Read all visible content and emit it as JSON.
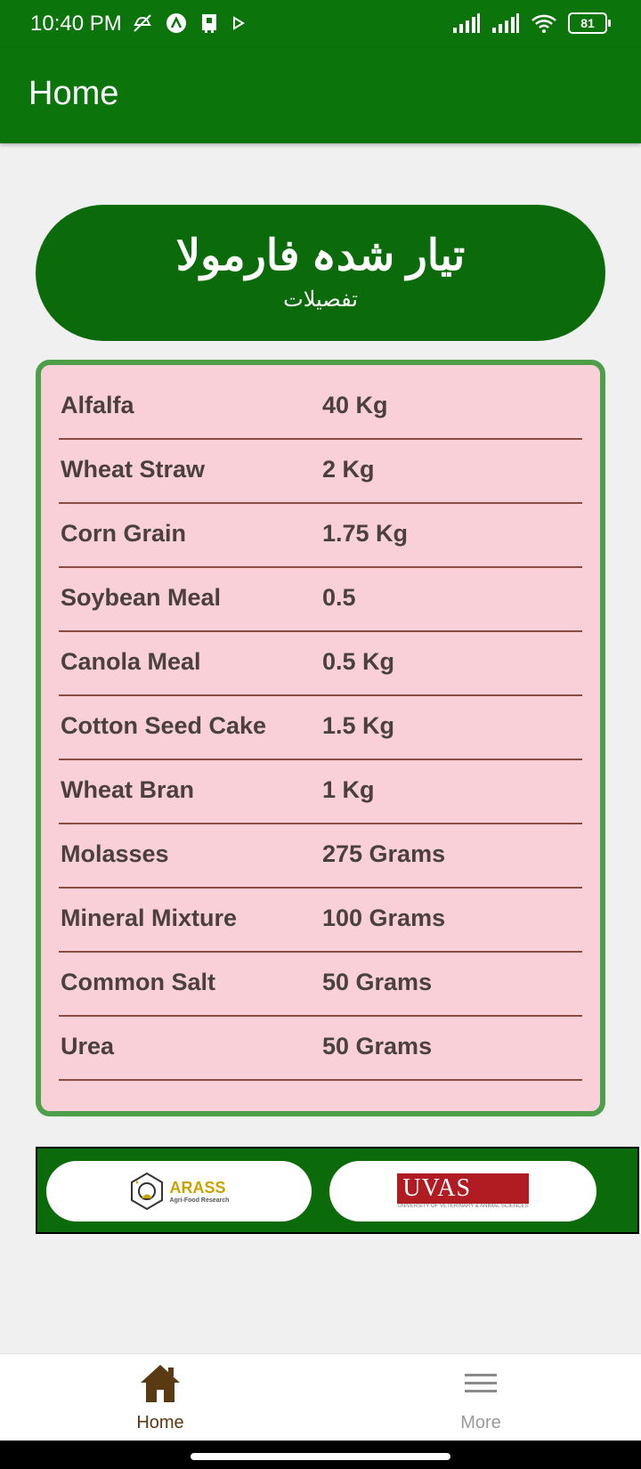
{
  "status": {
    "time": "10:40 PM",
    "battery": "81"
  },
  "app_bar": {
    "title": "Home"
  },
  "header": {
    "title": "تیار شدہ فارمولا",
    "subtitle": "تفصیلات"
  },
  "ingredients": [
    {
      "name": "Alfalfa",
      "qty": "40 Kg"
    },
    {
      "name": "Wheat Straw",
      "qty": "2 Kg"
    },
    {
      "name": "Corn Grain",
      "qty": "1.75 Kg"
    },
    {
      "name": "Soybean Meal",
      "qty": "0.5"
    },
    {
      "name": "Canola Meal",
      "qty": "0.5 Kg"
    },
    {
      "name": "Cotton Seed Cake",
      "qty": "1.5 Kg"
    },
    {
      "name": "Wheat Bran",
      "qty": "1 Kg"
    },
    {
      "name": "Molasses",
      "qty": "275 Grams"
    },
    {
      "name": "Mineral Mixture",
      "qty": "100 Grams"
    },
    {
      "name": "Common Salt",
      "qty": "50 Grams"
    },
    {
      "name": "Urea",
      "qty": "50 Grams"
    }
  ],
  "logos": {
    "left_name": "ARASS",
    "left_sub": "Agri-Food Research",
    "right_name": "UVAS",
    "right_sub": "UNIVERSITY OF VETERINARY & ANIMAL SCIENCES"
  },
  "nav": {
    "home_label": "Home",
    "more_label": "More"
  },
  "colors": {
    "primary_green": "#0b740b",
    "card_pink": "#f9cfd8",
    "card_border": "#4e9f4a",
    "row_divider": "#8d4a3e",
    "nav_active": "#5a3a12"
  }
}
